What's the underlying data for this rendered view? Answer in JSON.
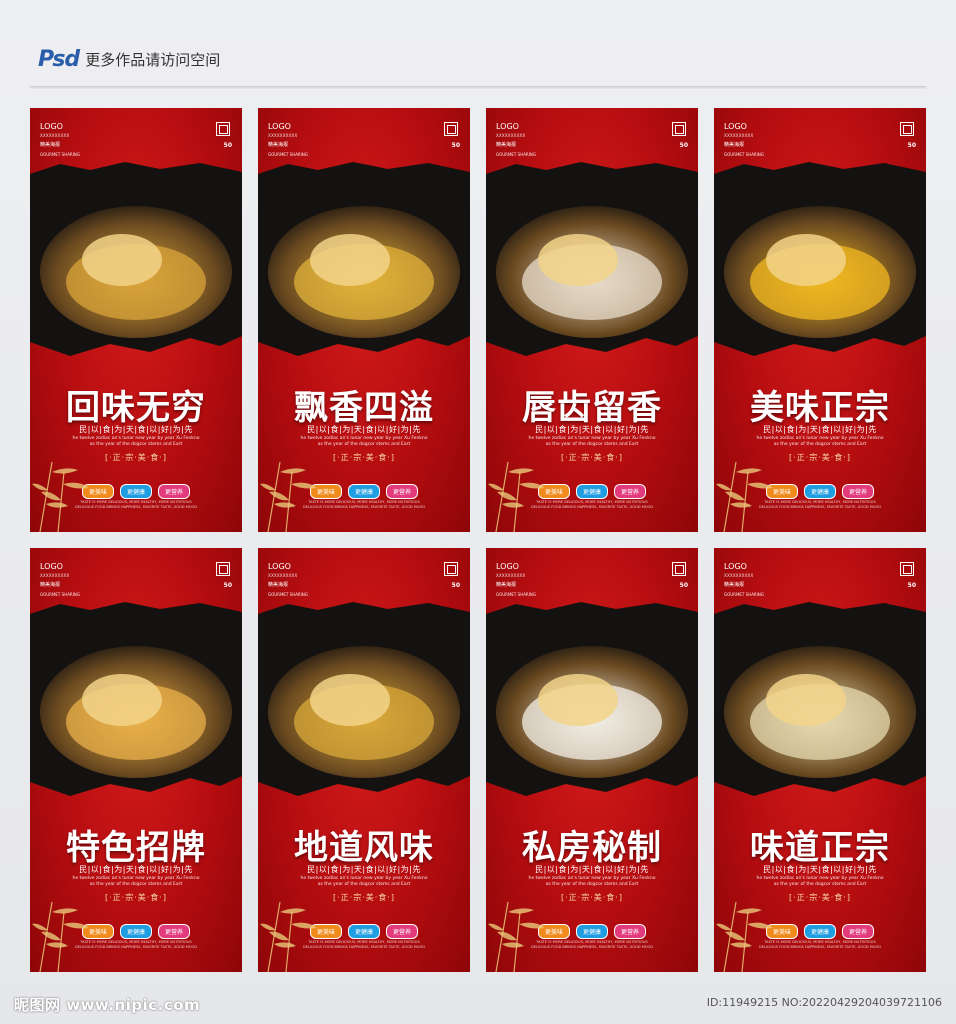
{
  "header": {
    "logo": "Psd",
    "text": "更多作品请访问空间"
  },
  "poster_common": {
    "logo": "LOGO",
    "logo_sub": "XXXXXXXXXX",
    "brand_cn": "精美海报",
    "brand_en": "GOURMET SHARING",
    "num": "50",
    "slogan": "民|以|食|为|天|食|以|好|为|先",
    "en_line1": "he twelve zodiac an's lunar new year by year Xu Fenkno",
    "en_line2": "as the year of the dogcor stems and Eart",
    "tag": "[·正·宗·美·食·]",
    "badge1": "更美味",
    "badge2": "更健康",
    "badge3": "更营养",
    "small1": "TASTE IS MORE DELICIOUS, MORE HEALTHY, MORE NUTRITIOUS",
    "small2": "DELICIOUS FOOD BRINGS HAPPINESS, FAVORITE TASTE, GOOD MOOD"
  },
  "posters": [
    {
      "title": "回味无穷",
      "accent": "#d9a43a"
    },
    {
      "title": "飘香四溢",
      "accent": "#e0b23a"
    },
    {
      "title": "唇齿留香",
      "accent": "#e8dccb"
    },
    {
      "title": "美味正宗",
      "accent": "#f0b820"
    },
    {
      "title": "特色招牌",
      "accent": "#e9b04a"
    },
    {
      "title": "地道风味",
      "accent": "#d8a83a"
    },
    {
      "title": "私房秘制",
      "accent": "#f3efe6"
    },
    {
      "title": "味道正宗",
      "accent": "#e6d9b0"
    }
  ],
  "footer": {
    "left": "昵图网 www.nipic.com",
    "right": "ID:11949215 NO:20220429204039721106"
  }
}
